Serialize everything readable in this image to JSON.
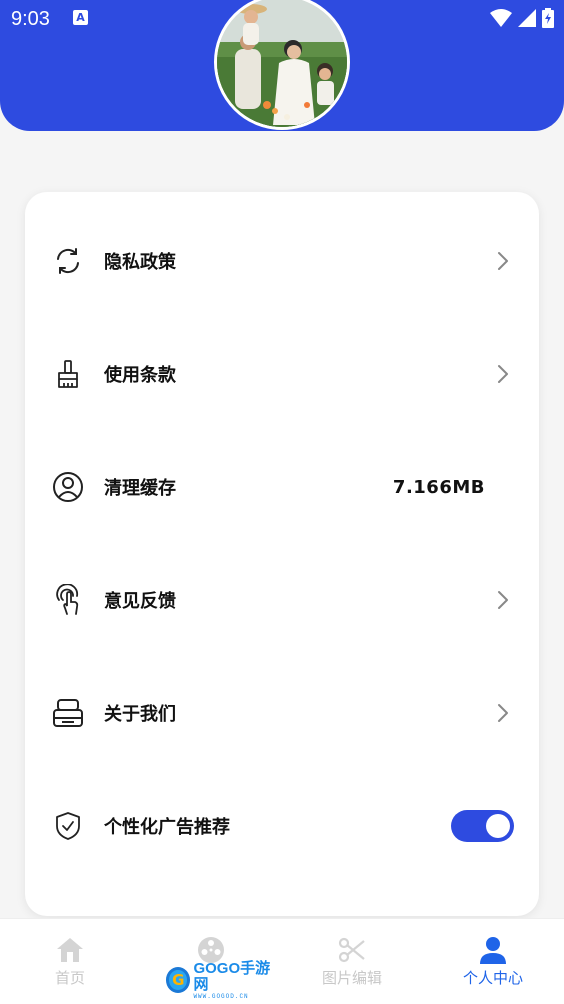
{
  "status_bar": {
    "time": "9:03",
    "notification_badge": "A"
  },
  "header": {
    "accent_color": "#2e4be0",
    "avatar_icon": "family-photo-avatar"
  },
  "settings": {
    "items": [
      {
        "label": "隐私政策",
        "icon": "refresh-icon",
        "trailing": "chevron"
      },
      {
        "label": "使用条款",
        "icon": "brush-icon",
        "trailing": "chevron"
      },
      {
        "label": "清理缓存",
        "icon": "user-circle-icon",
        "trailing": "value",
        "value": "7.166MB"
      },
      {
        "label": "意见反馈",
        "icon": "touch-icon",
        "trailing": "chevron"
      },
      {
        "label": "关于我们",
        "icon": "printer-icon",
        "trailing": "chevron"
      },
      {
        "label": "个性化广告推荐",
        "icon": "shield-check-icon",
        "trailing": "toggle",
        "toggle_on": true
      }
    ]
  },
  "bottom_nav": {
    "items": [
      {
        "label": "首页",
        "icon": "home-icon",
        "active": false
      },
      {
        "label": "",
        "icon": "film-reel-icon",
        "active": false
      },
      {
        "label": "图片编辑",
        "icon": "scissors-icon",
        "active": false
      },
      {
        "label": "个人中心",
        "icon": "person-icon",
        "active": true
      }
    ],
    "active_color": "#1f64e8",
    "inactive_color": "#c8c8c8"
  },
  "watermark": {
    "main": "GOGO手游网",
    "sub": "WWW.GOGOD.CN",
    "letter": "G"
  }
}
